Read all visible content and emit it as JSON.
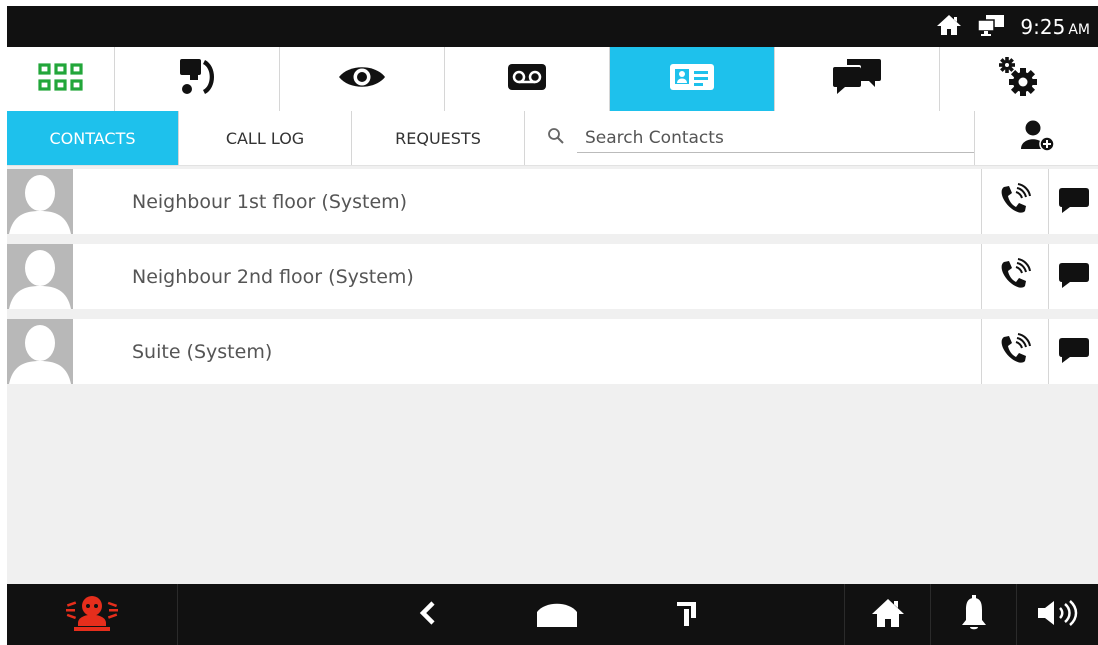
{
  "status_bar": {
    "time": "9:25",
    "ampm": "AM",
    "icons": [
      "home-status-icon",
      "network-status-icon"
    ]
  },
  "top_nav": {
    "active_tab": "contacts",
    "tabs": [
      {
        "id": "apps",
        "icon": "grid-icon"
      },
      {
        "id": "intercom",
        "icon": "intercom-icon"
      },
      {
        "id": "camera",
        "icon": "eye-icon"
      },
      {
        "id": "voicemail",
        "icon": "voicemail-icon"
      },
      {
        "id": "contacts",
        "icon": "contact-card-icon"
      },
      {
        "id": "messages",
        "icon": "chat-icon"
      },
      {
        "id": "settings",
        "icon": "gear-icon"
      }
    ]
  },
  "sub_nav": {
    "contacts_label": "CONTACTS",
    "call_log_label": "CALL LOG",
    "requests_label": "REQUESTS",
    "active": "CONTACTS"
  },
  "search": {
    "placeholder": "Search Contacts",
    "value": ""
  },
  "contacts": [
    {
      "name": "Neighbour 1st floor (System)"
    },
    {
      "name": "Neighbour 2nd floor (System)"
    },
    {
      "name": "Suite (System)"
    }
  ],
  "bottom_bar": {
    "icons": [
      "alarm-icon",
      "back-icon",
      "home-shape-icon",
      "recent-apps-icon",
      "home-icon",
      "bell-icon",
      "volume-icon"
    ]
  },
  "colors": {
    "accent": "#1ec1ec",
    "grid_icon": "#22a63a",
    "alarm": "#e62e1c",
    "bars": "#111111"
  }
}
